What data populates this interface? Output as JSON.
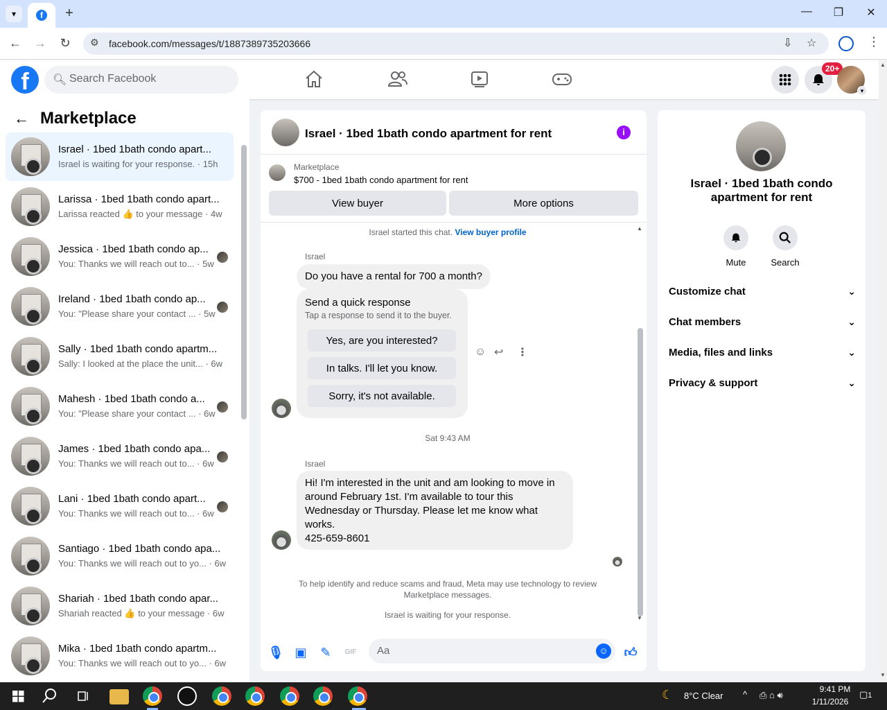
{
  "browser": {
    "url": "facebook.com/messages/t/1887389735203666"
  },
  "fbnav": {
    "search_placeholder": "Search Facebook",
    "notification_badge": "20+"
  },
  "left": {
    "title": "Marketplace",
    "conversations": [
      {
        "title": "Israel · 1bed 1bath condo apart...",
        "preview": "Israel is waiting for your response. · 15h"
      },
      {
        "title": "Larissa · 1bed 1bath condo apart...",
        "preview": "Larissa reacted 👍 to your message · 4w"
      },
      {
        "title": "Jessica · 1bed 1bath condo ap...",
        "preview": "You: Thanks we will reach out to... · 5w"
      },
      {
        "title": "Ireland · 1bed 1bath condo ap...",
        "preview": "You: \"Please share your contact ... · 5w"
      },
      {
        "title": "Sally · 1bed 1bath condo apartm...",
        "preview": "Sally: I looked at the place the unit... · 6w"
      },
      {
        "title": "Mahesh · 1bed 1bath condo a...",
        "preview": "You: \"Please share your contact ... · 6w"
      },
      {
        "title": "James · 1bed 1bath condo apa...",
        "preview": "You: Thanks we will reach out to... · 6w"
      },
      {
        "title": "Lani · 1bed 1bath condo apart...",
        "preview": "You: Thanks we will reach out to... · 6w"
      },
      {
        "title": "Santiago · 1bed 1bath condo apa...",
        "preview": "You: Thanks we will reach out to yo... · 6w"
      },
      {
        "title": "Shariah · 1bed 1bath condo apar...",
        "preview": "Shariah reacted 👍 to your message · 6w"
      },
      {
        "title": "Mika · 1bed 1bath condo apartm...",
        "preview": "You: Thanks we will reach out to yo... · 6w"
      }
    ]
  },
  "chat": {
    "title": "Israel · 1bed 1bath condo apartment for rent",
    "marketplace_label": "Marketplace",
    "listing": "$700 - 1bed 1bath condo apartment for rent",
    "view_buyer": "View buyer",
    "more_options": "More options",
    "started": "Israel started this chat.",
    "view_profile": "View buyer profile",
    "sender": "Israel",
    "msg1": "Do you have a rental for 700 a month?",
    "quick_title": "Send a quick response",
    "quick_sub": "Tap a response to send it to the buyer.",
    "quick1": "Yes, are you interested?",
    "quick2": "In talks. I'll let you know.",
    "quick3": "Sorry, it's not available.",
    "timestamp": "Sat 9:43 AM",
    "msg2_line1": "Hi! I'm interested in the unit and am looking to move in",
    "msg2_line2": "around February 1st. I'm available to tour this",
    "msg2_line3": "Wednesday or Thursday. Please let me know what",
    "msg2_line4": "works.",
    "msg2_line5": "425-659-8601",
    "disclaimer1": "To help identify and reduce scams and fraud, Meta may use technology to review",
    "disclaimer2": "Marketplace messages.",
    "waiting": "Israel is waiting for your response.",
    "composer_placeholder": "Aa"
  },
  "right": {
    "name_line1": "Israel · 1bed 1bath condo",
    "name_line2": "apartment for rent",
    "mute": "Mute",
    "search": "Search",
    "sections": [
      "Customize chat",
      "Chat members",
      "Media, files and links",
      "Privacy & support"
    ]
  },
  "taskbar": {
    "weather": "8°C  Clear",
    "time": "9:41 PM",
    "date": "1/11/2026",
    "notif_count": "1"
  }
}
